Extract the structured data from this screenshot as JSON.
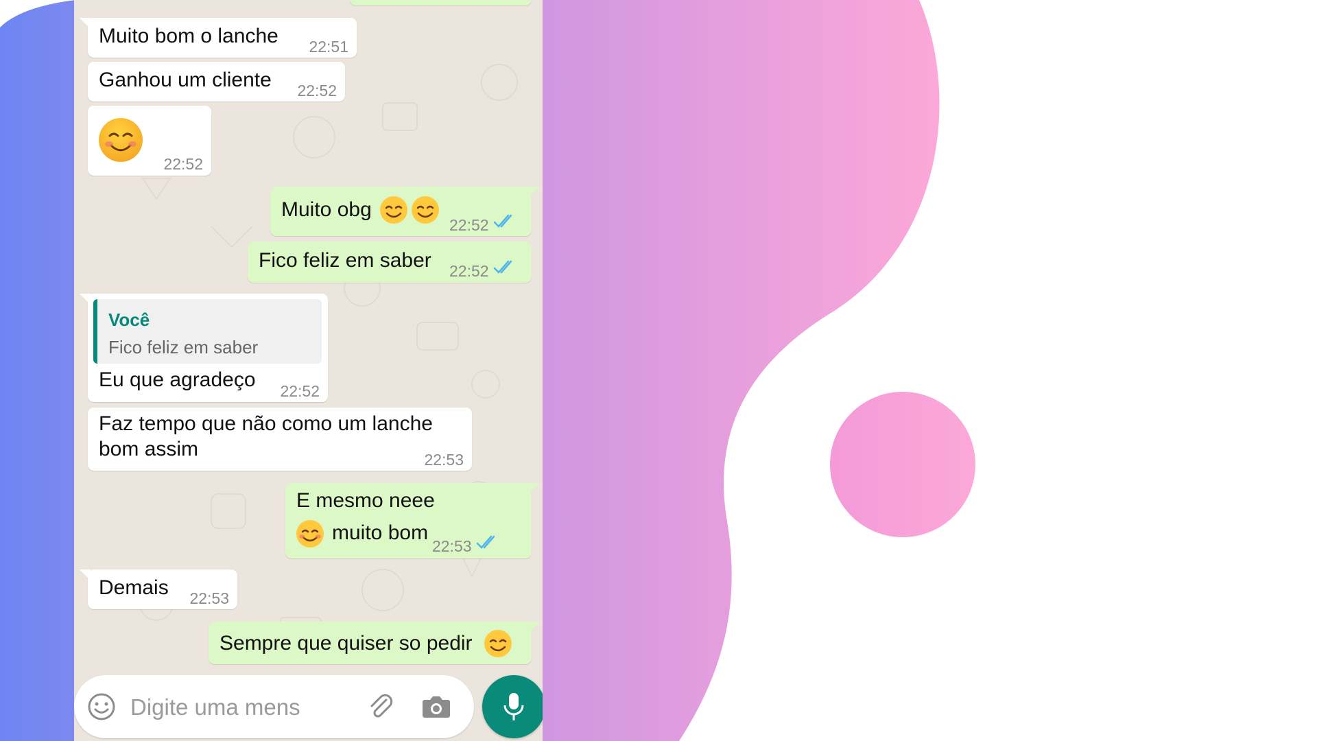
{
  "colors": {
    "outgoing_bubble": "#dcf8c6",
    "incoming_bubble": "#ffffff",
    "chat_background": "#ece5dd",
    "accent": "#07887a",
    "read_ticks": "#4fb6ec",
    "gradient_start": "#6e86f2",
    "gradient_end": "#fca8d8"
  },
  "messages": [
    {
      "text": "Muito bom o lanche",
      "time": "22:51",
      "direction": "in"
    },
    {
      "text": "Ganhou um cliente",
      "time": "22:52",
      "direction": "in"
    },
    {
      "text": "",
      "emoji": "smiling-face-icon",
      "time": "22:52",
      "direction": "in"
    },
    {
      "text": "Muito obg",
      "emoji": "smiling-face-icon",
      "time": "22:52",
      "direction": "out",
      "status": "read"
    },
    {
      "text": "Fico feliz em saber",
      "time": "22:52",
      "direction": "out",
      "status": "read"
    },
    {
      "reply_to": {
        "author": "Você",
        "text": "Fico feliz em saber"
      },
      "text": "Eu que agradeço",
      "time": "22:52",
      "direction": "in"
    },
    {
      "line1": "Faz tempo que não como um lanche",
      "line2": "bom assim",
      "time": "22:53",
      "direction": "in"
    },
    {
      "line1": "E mesmo neee",
      "line2": "muito bom",
      "time": "22:53",
      "direction": "out",
      "status": "read"
    },
    {
      "text": "Demais",
      "time": "22:53",
      "direction": "in"
    },
    {
      "text": "Sempre que quiser so pedir",
      "direction": "out"
    }
  ],
  "composer": {
    "placeholder": "Digite uma mens...",
    "icons": [
      "emoji-icon",
      "attach-icon",
      "camera-icon",
      "mic-icon"
    ]
  }
}
